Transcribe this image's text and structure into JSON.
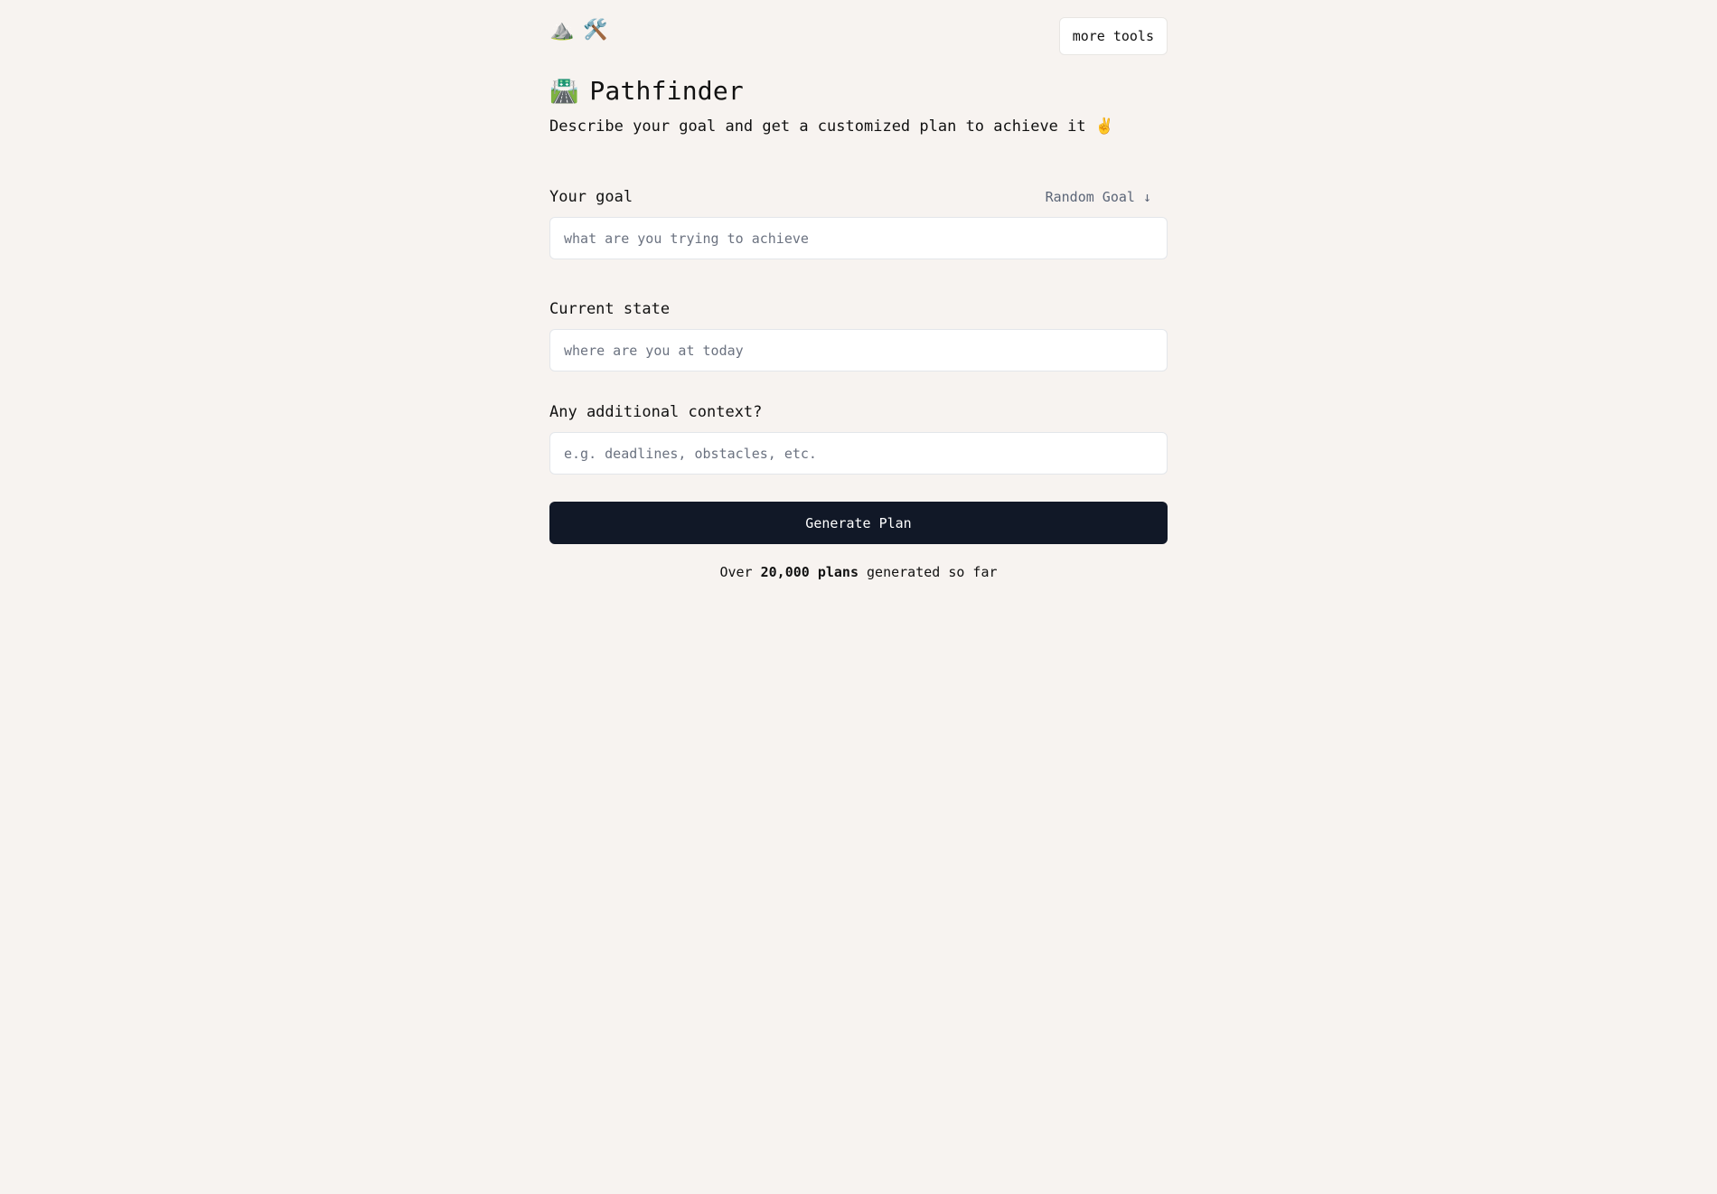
{
  "header": {
    "logo_icons": [
      {
        "name": "mountain-icon",
        "glyph": "⛰️"
      },
      {
        "name": "hammer-wrench-icon",
        "glyph": "🛠️"
      }
    ],
    "more_tools_label": "more tools"
  },
  "hero": {
    "title_icon": "🛣️",
    "title": "Pathfinder",
    "subtitle": "Describe your goal and get a customized plan to achieve it ✌️"
  },
  "form": {
    "goal": {
      "label": "Your goal",
      "random_label": "Random Goal ↓",
      "value": "",
      "placeholder": "what are you trying to achieve"
    },
    "current_state": {
      "label": "Current state",
      "value": "",
      "placeholder": "where are you at today"
    },
    "context": {
      "label": "Any additional context?",
      "value": "",
      "placeholder": "e.g. deadlines, obstacles, etc."
    },
    "submit_label": "Generate Plan"
  },
  "stats": {
    "prefix": "Over",
    "count": "20,000 plans",
    "suffix": "generated so far"
  },
  "colors": {
    "background": "#f7f3f0",
    "primary_button": "#111827",
    "muted_text": "#5b6577"
  }
}
